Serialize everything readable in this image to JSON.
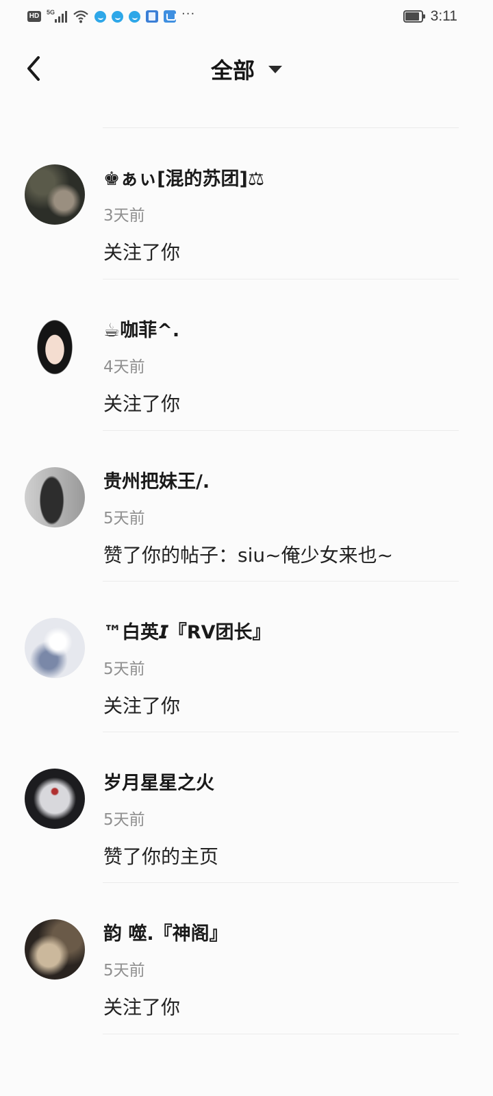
{
  "status_bar": {
    "hd": "HD",
    "network": "5G",
    "time": "3:11",
    "battery_level": 0.85,
    "icons": [
      "hd-icon",
      "signal-icon",
      "wifi-icon",
      "app-notification-icon",
      "app-notification-icon",
      "app-notification-icon",
      "app-icon",
      "app-store-icon",
      "more-icon",
      "battery-icon"
    ]
  },
  "header": {
    "title": "全部",
    "back_icon": "chevron-left-icon",
    "dropdown_icon": "caret-down-icon"
  },
  "partial_item": {
    "text": ""
  },
  "items": [
    {
      "name": "♚ぁぃ[混的苏团]⚖",
      "time": "3天前",
      "action": "关注了你",
      "avatar_colors": [
        "#2c2e28",
        "#5a5a4a",
        "#9a8f80"
      ]
    },
    {
      "name": "☕咖菲^.",
      "time": "4天前",
      "action": "关注了你",
      "avatar_colors": [
        "#fbfbfb",
        "#151515",
        "#f4ddd0"
      ]
    },
    {
      "name": "贵州把妹王/.",
      "time": "5天前",
      "action": "赞了你的帖子：siu~俺少女来也~",
      "avatar_colors": [
        "#cfcfcf",
        "#2d2d2d",
        "#9a9a9a"
      ]
    },
    {
      "name": "™白英𝙄『RV团长』",
      "time": "5天前",
      "action": "关注了你",
      "avatar_colors": [
        "#e6e8ee",
        "#7a88a8",
        "#b9c3d8"
      ]
    },
    {
      "name": "岁月星星之火",
      "time": "5天前",
      "action": "赞了你的主页",
      "avatar_colors": [
        "#1c1c1f",
        "#d8d8dc",
        "#b03030"
      ]
    },
    {
      "name": "韵  噬.『神阁』",
      "time": "5天前",
      "action": "关注了你",
      "avatar_colors": [
        "#6a5a48",
        "#cbb89c",
        "#2a2420"
      ]
    }
  ]
}
